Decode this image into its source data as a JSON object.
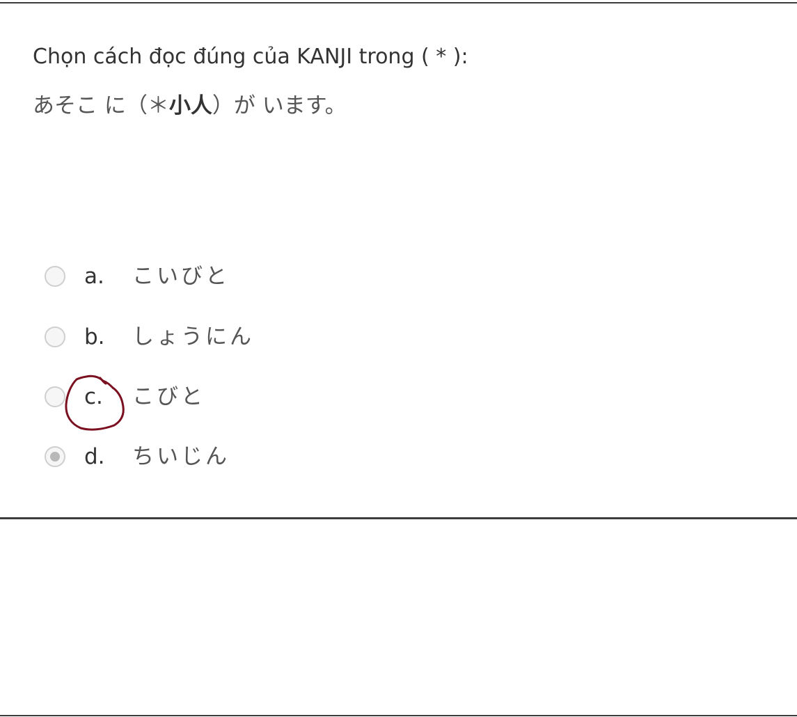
{
  "question": {
    "prompt": "Chọn cách đọc đúng của KANJI trong ( * ):",
    "sentence_before": "あそこ に（＊",
    "sentence_kanji": "小人",
    "sentence_after": "）が います。"
  },
  "choices": [
    {
      "letter": "a.",
      "text": "こいびと",
      "selected": false
    },
    {
      "letter": "b.",
      "text": "しょうにん",
      "selected": false
    },
    {
      "letter": "c.",
      "text": "こびと",
      "selected": false
    },
    {
      "letter": "d.",
      "text": "ちいじん",
      "selected": true
    }
  ],
  "colors": {
    "rule": "#3c3c3c",
    "annotation": "#7a1020",
    "text": "#333333"
  }
}
